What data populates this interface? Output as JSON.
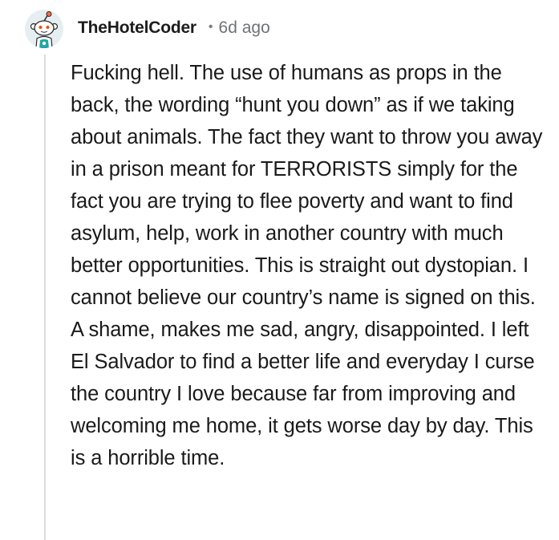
{
  "comment": {
    "author": "TheHotelCoder",
    "separator": "•",
    "time_ago": "6d ago",
    "avatar_icon": "reddit-snoo-avatar-icon",
    "body": "Fucking hell. The use of humans as props in the back, the wording “hunt you down” as if we taking about animals. The fact they want to throw you away in a prison meant for TERRORISTS simply for the fact you are trying to flee poverty and want to find asylum, help, work in another country with much better opportunities. This is straight out dystopian. I cannot believe our country’s name is signed on this. A shame, makes me sad, angry, disappointed. I left El Salvador to find a better life and everyday I curse the country I love because far from improving and welcoming me home, it gets worse day by day. This is a horrible time."
  },
  "colors": {
    "thread_line": "#dadcde",
    "text": "#1a1a1b",
    "meta": "#6f7376",
    "avatar_bg": "#e6eef2"
  }
}
